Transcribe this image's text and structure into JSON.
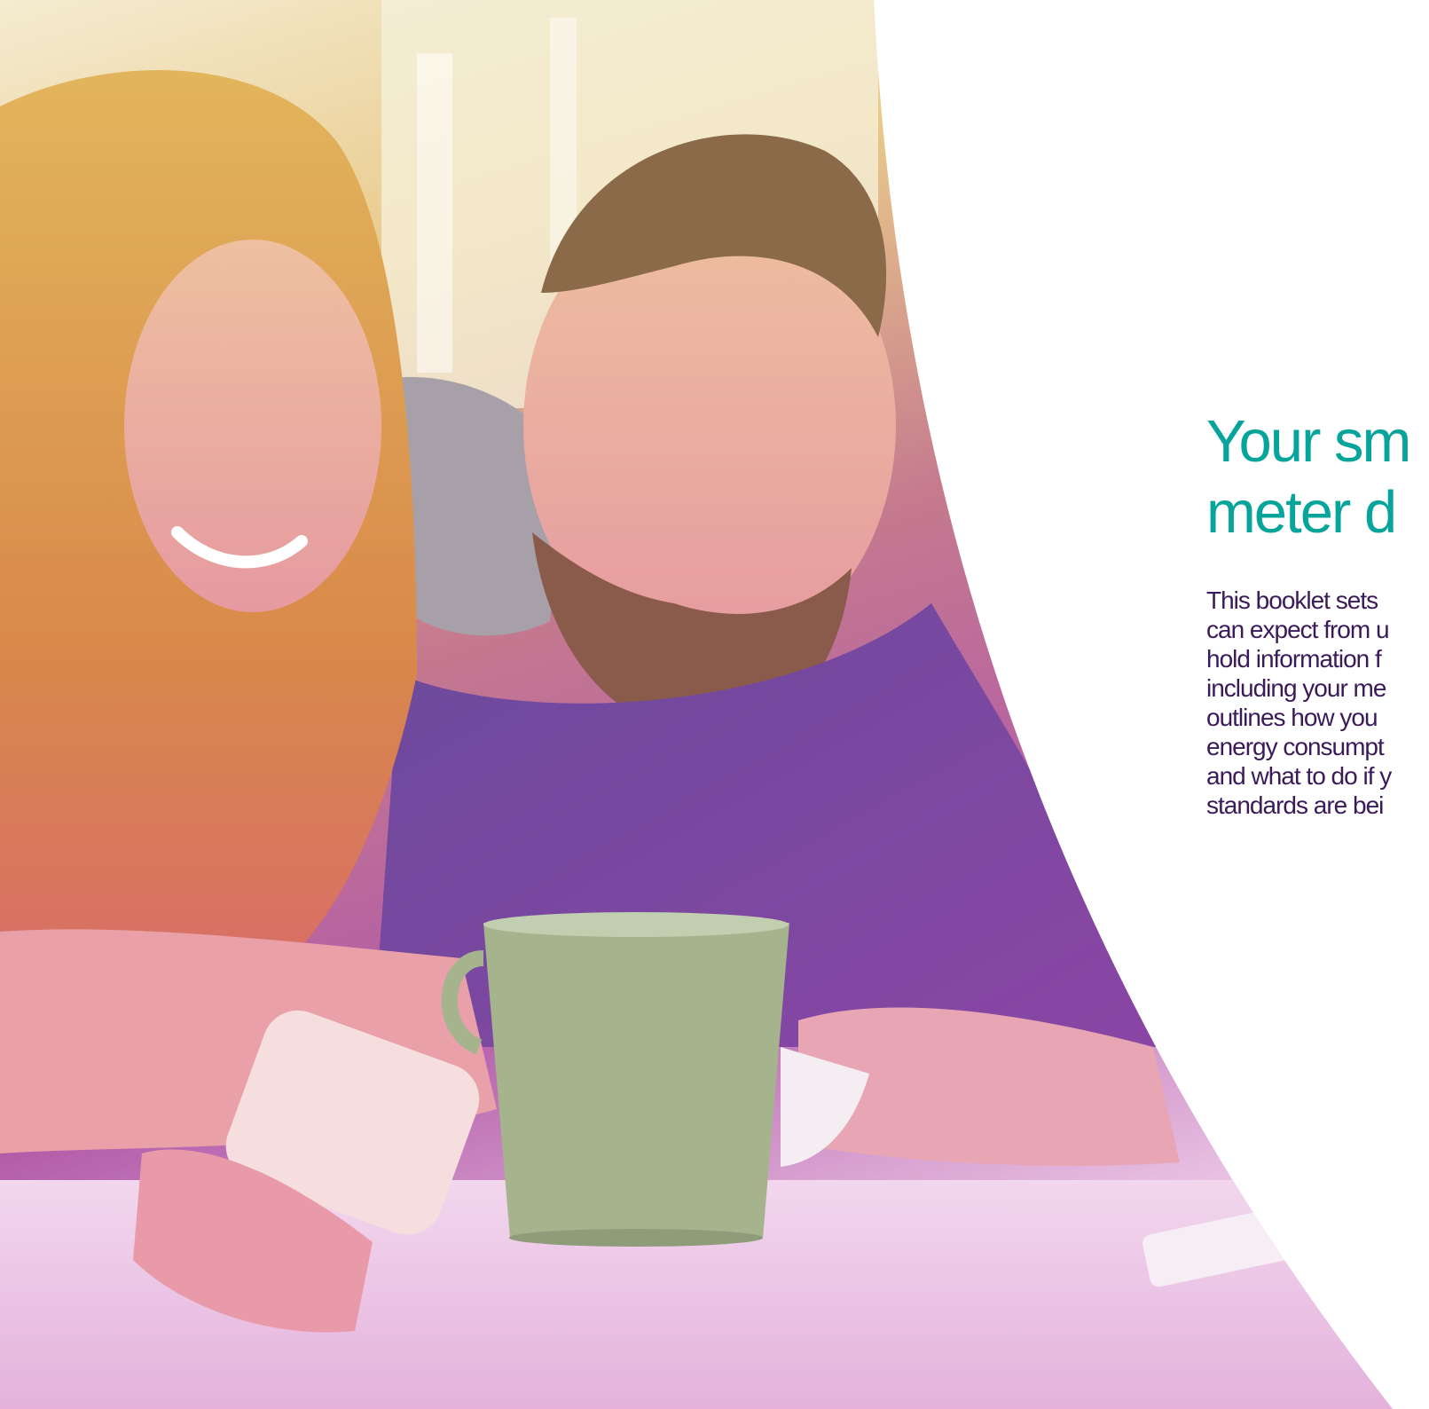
{
  "colors": {
    "heading": "#06a49a",
    "body_text": "#3b1a5a",
    "photo_overlay_top": "#f2e6a0",
    "photo_overlay_mid": "#b45ab0",
    "photo_overlay_bottom": "#e7b6df"
  },
  "photo": {
    "subject": "couple-smiling-with-phone-and-mug"
  },
  "heading": {
    "lines": [
      "Your sm",
      "meter d"
    ]
  },
  "body": {
    "lines": [
      "This booklet sets",
      "can expect from u",
      "hold information f",
      "including your me",
      "outlines how you",
      "energy consumpt",
      "and what to do if y",
      "standards are bei"
    ]
  }
}
